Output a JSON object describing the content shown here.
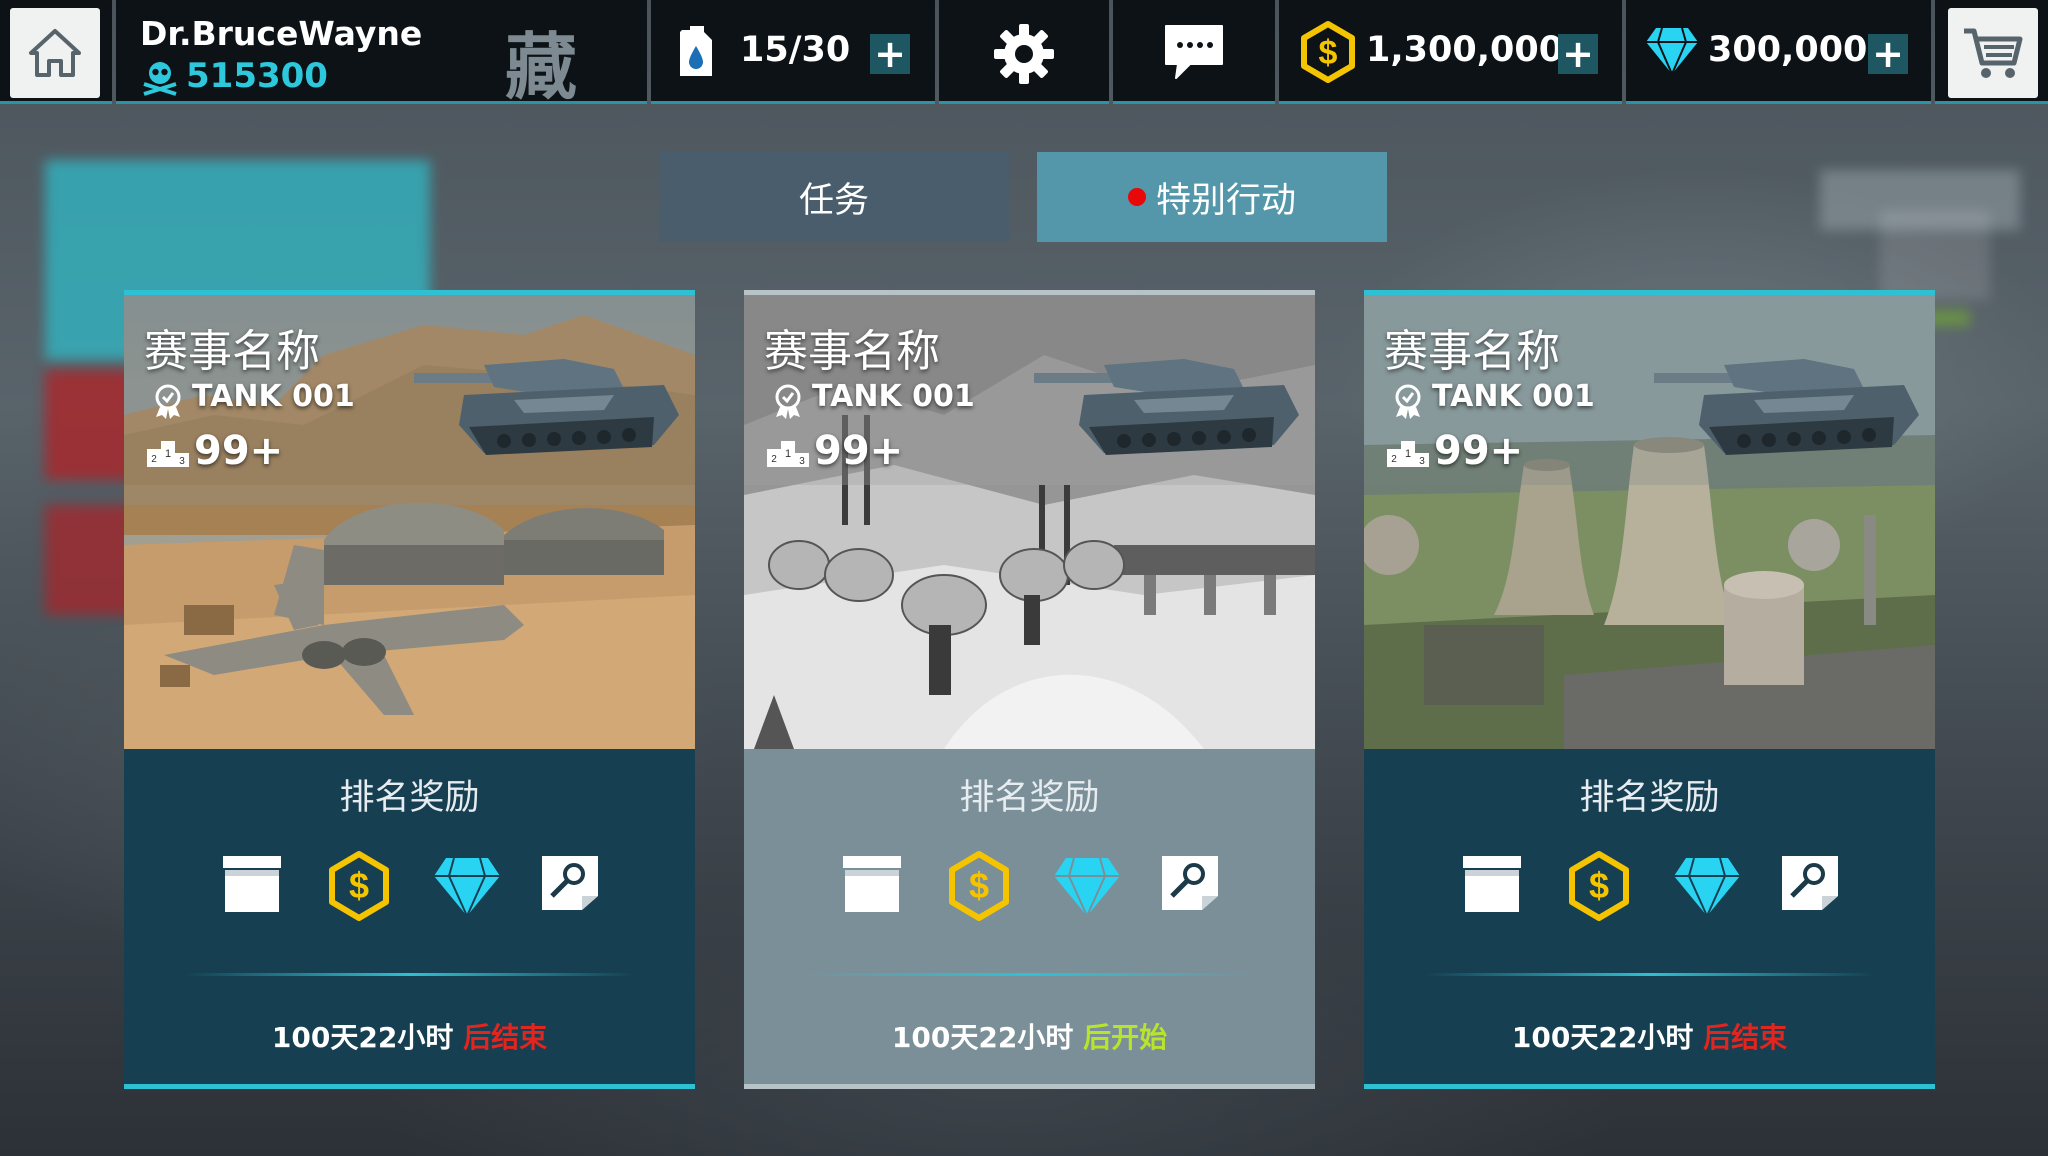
{
  "header": {
    "user_name": "Dr.BruceWayne",
    "user_score": "515300",
    "collect_label": "藏",
    "fuel": "15/30",
    "coins": "1,300,000",
    "gems": "300,000"
  },
  "tabs": [
    {
      "label": "任务",
      "active": false
    },
    {
      "label": "特别行动",
      "active": true,
      "badge": true
    }
  ],
  "cards": [
    {
      "title": "赛事名称",
      "tank": "TANK 001",
      "rank": "99+",
      "reward_label": "排名奖励",
      "timer_prefix": "100天22小时 ",
      "timer_suffix": "后结束",
      "theme": "desert"
    },
    {
      "title": "赛事名称",
      "tank": "TANK 001",
      "rank": "99+",
      "reward_label": "排名奖励",
      "timer_prefix": "100天22小时 ",
      "timer_suffix": "后开始",
      "theme": "snow"
    },
    {
      "title": "赛事名称",
      "tank": "TANK 001",
      "rank": "99+",
      "reward_label": "排名奖励",
      "timer_prefix": "100天22小时 ",
      "timer_suffix": "后结束",
      "theme": "plant"
    }
  ],
  "colors": {
    "accent": "#2ec1d3",
    "coin": "#f5c400",
    "gem": "#29d4f2",
    "timer_end": "#e2251f",
    "timer_start": "#b8e42b"
  }
}
